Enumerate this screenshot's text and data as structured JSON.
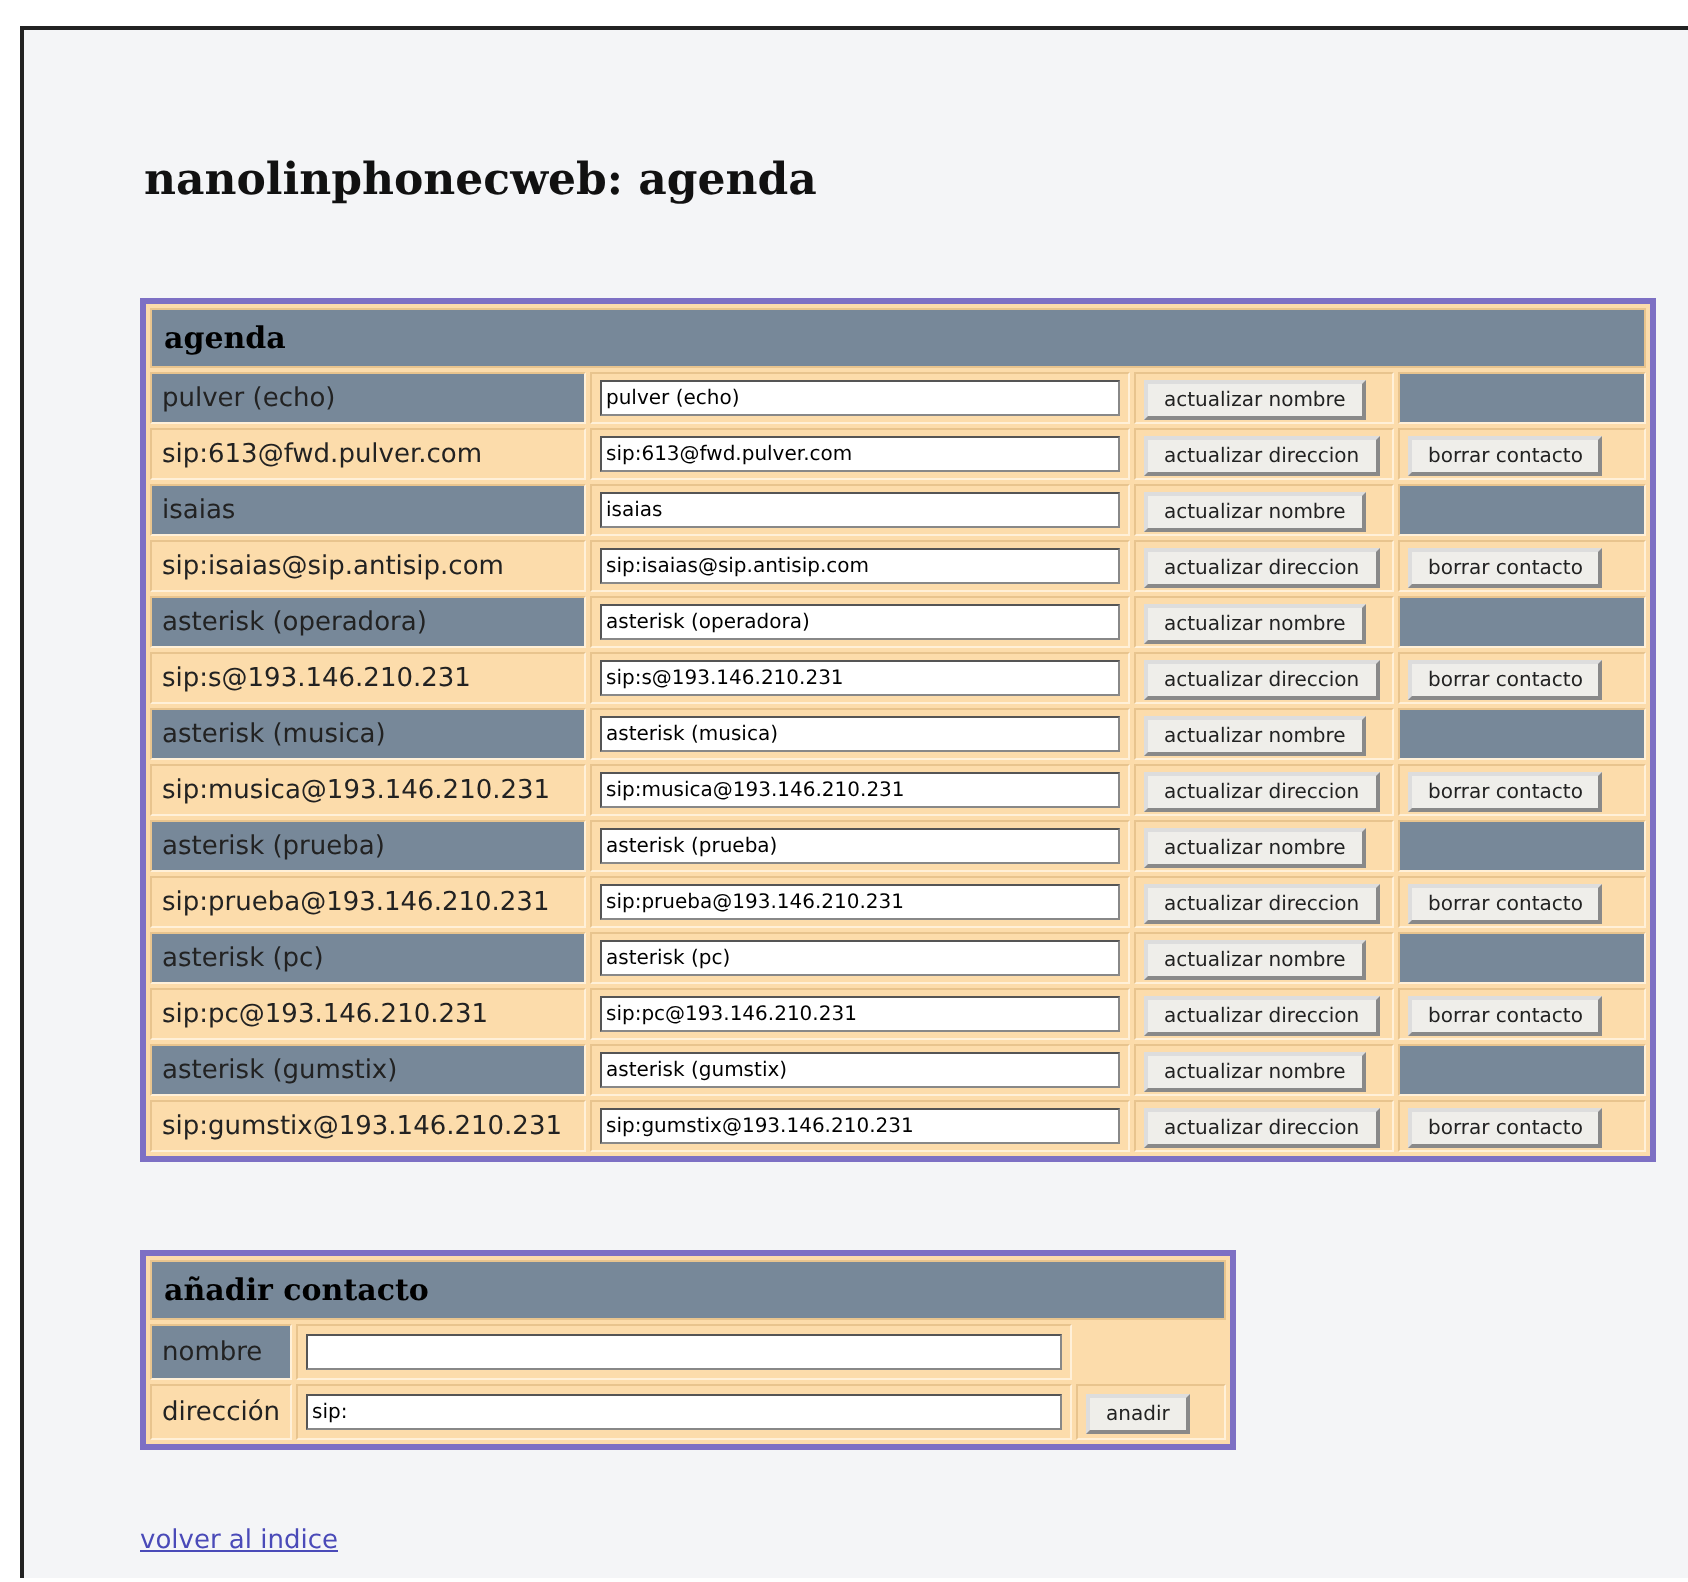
{
  "page": {
    "title": "nanolinphonecweb: agenda"
  },
  "agenda": {
    "title": "agenda",
    "rows": [
      {
        "kind": "name",
        "label": "pulver (echo)",
        "value": "pulver (echo)",
        "button": "actualizar nombre"
      },
      {
        "kind": "address",
        "label": "sip:613@fwd.pulver.com",
        "value": "sip:613@fwd.pulver.com",
        "button": "actualizar direccion",
        "delete_button": "borrar contacto"
      },
      {
        "kind": "name",
        "label": "isaias",
        "value": "isaias",
        "button": "actualizar nombre"
      },
      {
        "kind": "address",
        "label": "sip:isaias@sip.antisip.com",
        "value": "sip:isaias@sip.antisip.com",
        "button": "actualizar direccion",
        "delete_button": "borrar contacto"
      },
      {
        "kind": "name",
        "label": "asterisk (operadora)",
        "value": "asterisk (operadora)",
        "button": "actualizar nombre"
      },
      {
        "kind": "address",
        "label": "sip:s@193.146.210.231",
        "value": "sip:s@193.146.210.231",
        "button": "actualizar direccion",
        "delete_button": "borrar contacto"
      },
      {
        "kind": "name",
        "label": "asterisk (musica)",
        "value": "asterisk (musica)",
        "button": "actualizar nombre"
      },
      {
        "kind": "address",
        "label": "sip:musica@193.146.210.231",
        "value": "sip:musica@193.146.210.231",
        "button": "actualizar direccion",
        "delete_button": "borrar contacto"
      },
      {
        "kind": "name",
        "label": "asterisk (prueba)",
        "value": "asterisk (prueba)",
        "button": "actualizar nombre"
      },
      {
        "kind": "address",
        "label": "sip:prueba@193.146.210.231",
        "value": "sip:prueba@193.146.210.231",
        "button": "actualizar direccion",
        "delete_button": "borrar contacto"
      },
      {
        "kind": "name",
        "label": "asterisk (pc)",
        "value": "asterisk (pc)",
        "button": "actualizar nombre"
      },
      {
        "kind": "address",
        "label": "sip:pc@193.146.210.231",
        "value": "sip:pc@193.146.210.231",
        "button": "actualizar direccion",
        "delete_button": "borrar contacto"
      },
      {
        "kind": "name",
        "label": "asterisk (gumstix)",
        "value": "asterisk (gumstix)",
        "button": "actualizar nombre"
      },
      {
        "kind": "address",
        "label": "sip:gumstix@193.146.210.231",
        "value": "sip:gumstix@193.146.210.231",
        "button": "actualizar direccion",
        "delete_button": "borrar contacto"
      }
    ]
  },
  "add_contact": {
    "title": "añadir contacto",
    "fields": [
      {
        "kind": "name",
        "label": "nombre"
      },
      {
        "kind": "address",
        "label": "dirección",
        "value": "sip:"
      }
    ],
    "button": "anadir"
  },
  "back_link": "volver al indice"
}
